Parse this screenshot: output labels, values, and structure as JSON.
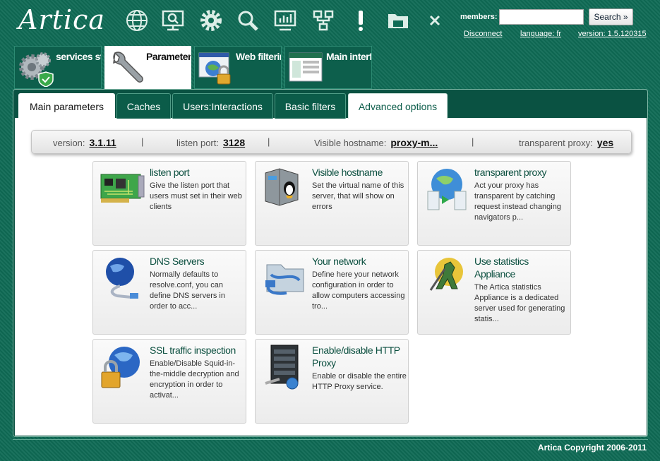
{
  "header": {
    "logo": "Artica",
    "icons": [
      "globe-icon",
      "monitor-search-icon",
      "gear-icon",
      "search-icon",
      "chart-icon",
      "network-icon",
      "alert-icon",
      "folder-icon",
      "close-icon"
    ],
    "members_label": "members:",
    "members_value": "",
    "search_label": "Search »",
    "links": {
      "disconnect": "Disconnect",
      "language": "language: fr",
      "version": "version: 1.5.120315"
    }
  },
  "module_tabs": [
    {
      "label": "services st",
      "icon": "services-gears-icon"
    },
    {
      "label": "Parameters",
      "icon": "wrench-icon"
    },
    {
      "label": "Web filterin",
      "icon": "web-filter-lock-icon"
    },
    {
      "label": "Main interf",
      "icon": "main-interface-screen-icon"
    }
  ],
  "panel_tabs": [
    "Main parameters",
    "Caches",
    "Users:Interactions",
    "Basic filters",
    "Advanced options"
  ],
  "status": {
    "version_label": "version:",
    "version_value": "3.1.11",
    "port_label": "listen port:",
    "port_value": "3128",
    "hostname_label": "Visible hostname:",
    "hostname_value": "proxy-m...",
    "transparent_label": "transparent proxy:",
    "transparent_value": "yes",
    "separator": "|"
  },
  "cards": [
    {
      "title": "listen port",
      "desc": "Give the listen port that users must set in their web clients",
      "icon": "network-card-icon"
    },
    {
      "title": "Visible hostname",
      "desc": "Set the virtual name of this server, that will show on errors",
      "icon": "server-linux-icon"
    },
    {
      "title": "transparent proxy",
      "desc": "Act your proxy has transparent by catching request instead changing navigators p...",
      "icon": "transparent-proxy-globe-icon"
    },
    {
      "title": "DNS Servers",
      "desc": "Normally defaults to resolve.conf, you can define DNS servers in order to acc...",
      "icon": "dns-globe-cable-icon"
    },
    {
      "title": "Your network",
      "desc": "Define here your network configuration in order to allow computers accessing tro...",
      "icon": "network-folder-cable-icon"
    },
    {
      "title": "Use statistics Appliance",
      "desc": "The Artica statistics Appliance is a dedicated server used for generating statis...",
      "icon": "statistics-appliance-icon"
    },
    {
      "title": "SSL traffic inspection",
      "desc": "Enable/Disable Squid-in-the-middle decryption and encryption in order to activat...",
      "icon": "ssl-globe-lock-icon"
    },
    {
      "title": "Enable/disable HTTP Proxy",
      "desc": "Enable or disable the entire HTTP Proxy service.",
      "icon": "server-rack-toggle-icon"
    }
  ],
  "footer": "Artica Copyright 2006-2011"
}
